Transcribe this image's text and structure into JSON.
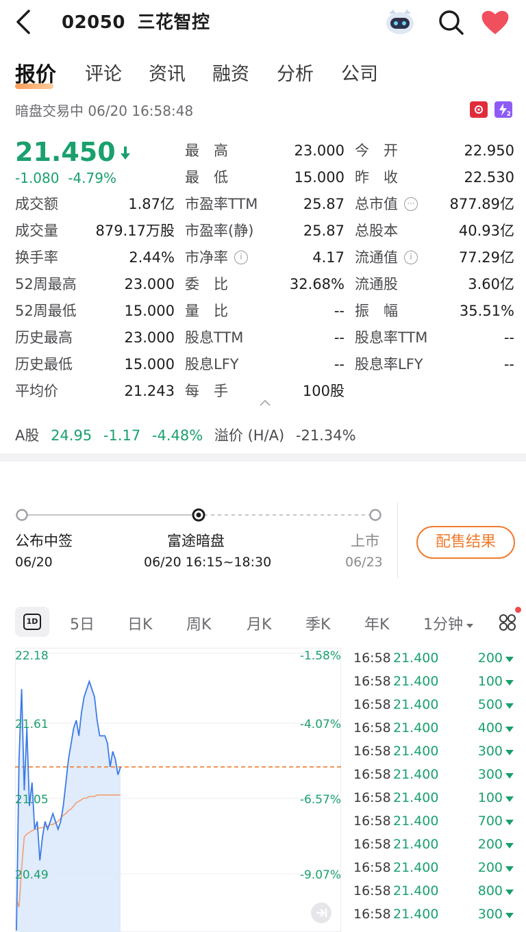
{
  "header": {
    "code": "02050",
    "name": "三花智控"
  },
  "tabs": [
    "报价",
    "评论",
    "资讯",
    "融资",
    "分析",
    "公司"
  ],
  "status": {
    "text": "暗盘交易中 06/20 16:58:48",
    "badge": "2"
  },
  "quote": {
    "price": "21.450",
    "change": "-1.080",
    "change_pct": "-4.79%",
    "rows": [
      [
        {
          "l": "",
          "v": ""
        },
        {
          "l": "最　高",
          "v": "23.000",
          "c": "red"
        },
        {
          "l": "今　开",
          "v": "22.950",
          "c": "red"
        }
      ],
      [
        {
          "l": "",
          "v": ""
        },
        {
          "l": "最　低",
          "v": "15.000",
          "c": "green"
        },
        {
          "l": "昨　收",
          "v": "22.530"
        }
      ],
      [
        {
          "l": "成交额",
          "v": "1.87亿"
        },
        {
          "l": "市盈率TTM",
          "v": "25.87"
        },
        {
          "l": "总市值",
          "v": "877.89亿",
          "info": true
        }
      ],
      [
        {
          "l": "成交量",
          "v": "879.17万股"
        },
        {
          "l": "市盈率(静)",
          "v": "25.87"
        },
        {
          "l": "总股本",
          "v": "40.93亿"
        }
      ],
      [
        {
          "l": "换手率",
          "v": "2.44%"
        },
        {
          "l": "市净率",
          "v": "4.17",
          "info": true
        },
        {
          "l": "流通值",
          "v": "77.29亿",
          "info": true
        }
      ],
      [
        {
          "l": "52周最高",
          "v": "23.000"
        },
        {
          "l": "委　比",
          "v": "32.68%"
        },
        {
          "l": "流通股",
          "v": "3.60亿"
        }
      ],
      [
        {
          "l": "52周最低",
          "v": "15.000"
        },
        {
          "l": "量　比",
          "v": "--"
        },
        {
          "l": "振　幅",
          "v": "35.51%"
        }
      ],
      [
        {
          "l": "历史最高",
          "v": "23.000"
        },
        {
          "l": "股息TTM",
          "v": "--"
        },
        {
          "l": "股息率TTM",
          "v": "--"
        }
      ],
      [
        {
          "l": "历史最低",
          "v": "15.000"
        },
        {
          "l": "股息LFY",
          "v": "--"
        },
        {
          "l": "股息率LFY",
          "v": "--"
        }
      ],
      [
        {
          "l": "平均价",
          "v": "21.243"
        },
        {
          "l": "每　手",
          "v": "100股"
        },
        {
          "l": "",
          "v": ""
        }
      ]
    ]
  },
  "ah": {
    "label": "A股",
    "price": "24.95",
    "change": "-1.17",
    "pct": "-4.48%",
    "premium_label": "溢价 (H/A)",
    "premium": "-21.34%"
  },
  "timeline": {
    "steps": [
      {
        "label": "公布中签",
        "date": "06/20"
      },
      {
        "label": "富途暗盘",
        "date": "06/20 16:15~18:30"
      },
      {
        "label": "上市",
        "date": "06/23"
      }
    ],
    "button": "配售结果"
  },
  "chart_tabs": [
    "5日",
    "日K",
    "周K",
    "月K",
    "季K",
    "年K",
    "1分钟"
  ],
  "chart_tab_active": "1D",
  "chart_data": {
    "type": "line",
    "y_labels": [
      "22.18",
      "21.61",
      "21.05",
      "20.49"
    ],
    "pct_labels": [
      "-1.58%",
      "-4.07%",
      "-6.57%",
      "-9.07%"
    ],
    "ylim": [
      20.39,
      22.18
    ],
    "reference_price": 21.45,
    "series": [
      {
        "values": [
          20.4,
          21.5,
          21.95,
          21.3,
          21.7,
          21.2,
          21.35,
          21.05,
          21.1,
          20.85,
          21.0,
          21.1,
          21.05,
          21.1,
          21.15,
          21.1,
          21.05,
          21.1,
          21.2,
          21.35,
          21.5,
          21.6,
          21.7,
          21.75,
          21.65,
          21.8,
          21.9,
          21.95,
          22.0,
          21.95,
          21.9,
          21.75,
          21.65,
          21.65,
          21.65,
          21.6,
          21.45,
          21.55,
          21.5,
          21.4,
          21.45
        ]
      },
      {
        "values": [
          20.6,
          20.55,
          20.8,
          21.0,
          21.02,
          21.03,
          21.04,
          21.05,
          21.05,
          21.06,
          21.06,
          21.07,
          21.07,
          21.08,
          21.08,
          21.09,
          21.1,
          21.12,
          21.14,
          21.15,
          21.17,
          21.18,
          21.2,
          21.22,
          21.23,
          21.24,
          21.25,
          21.25,
          21.26,
          21.26,
          21.26,
          21.27,
          21.27,
          21.27,
          21.27,
          21.27,
          21.27,
          21.27,
          21.27,
          21.27,
          21.27
        ]
      }
    ]
  },
  "trades": [
    {
      "t": "16:58",
      "p": "21.400",
      "v": "200"
    },
    {
      "t": "16:58",
      "p": "21.400",
      "v": "100"
    },
    {
      "t": "16:58",
      "p": "21.400",
      "v": "500"
    },
    {
      "t": "16:58",
      "p": "21.400",
      "v": "400"
    },
    {
      "t": "16:58",
      "p": "21.400",
      "v": "300"
    },
    {
      "t": "16:58",
      "p": "21.400",
      "v": "300"
    },
    {
      "t": "16:58",
      "p": "21.400",
      "v": "100"
    },
    {
      "t": "16:58",
      "p": "21.400",
      "v": "700"
    },
    {
      "t": "16:58",
      "p": "21.400",
      "v": "200"
    },
    {
      "t": "16:58",
      "p": "21.400",
      "v": "200"
    },
    {
      "t": "16:58",
      "p": "21.400",
      "v": "800"
    },
    {
      "t": "16:58",
      "p": "21.400",
      "v": "300"
    }
  ],
  "colors": {
    "up": "#e0323f",
    "down": "#1aa06d",
    "accent": "#f07b2d",
    "line": "#3a7be6",
    "avg": "#f0a070"
  }
}
